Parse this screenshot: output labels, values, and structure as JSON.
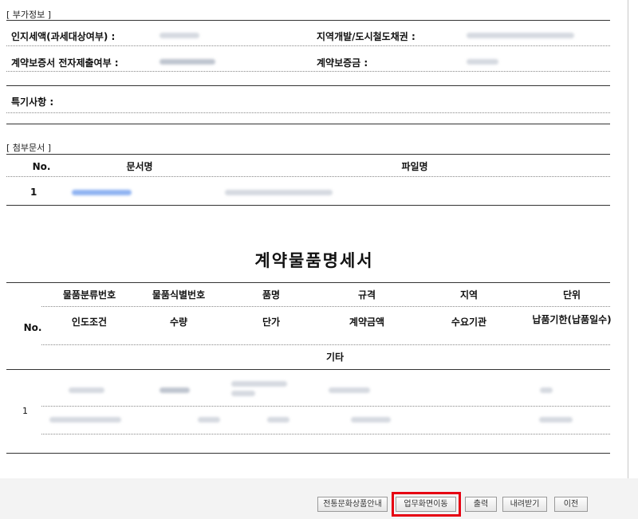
{
  "extra_info": {
    "section_title": "[ 부가정보 ]",
    "stamp_tax_label": "인지세액(과세대상여부) :",
    "regional_bond_label": "지역개발/도시철도채권 :",
    "guarantee_doc_label": "계약보증서 전자제출여부 :",
    "guarantee_amount_label": "계약보증금 :",
    "special_notes_label": "특기사항 :"
  },
  "attachments": {
    "section_title": "[ 첨부문서 ]",
    "headers": {
      "no": "No.",
      "doc_name": "문서명",
      "file_name": "파일명"
    },
    "rows": [
      {
        "no": "1"
      }
    ]
  },
  "item_spec": {
    "title": "계약물품명세서",
    "header_row1": [
      "물품분류번호",
      "물품식별번호",
      "품명",
      "규격",
      "지역",
      "단위"
    ],
    "header_no": "No.",
    "header_row2": [
      "인도조건",
      "수량",
      "단가",
      "계약금액",
      "수요기관",
      "납품기한(납품일수)"
    ],
    "header_row3": "기타",
    "rows": [
      {
        "no": "1"
      }
    ]
  },
  "buttons": {
    "traditional": "전통문화상품안내",
    "move": "업무화면이동",
    "print": "출력",
    "download": "내려받기",
    "prev": "이전"
  }
}
